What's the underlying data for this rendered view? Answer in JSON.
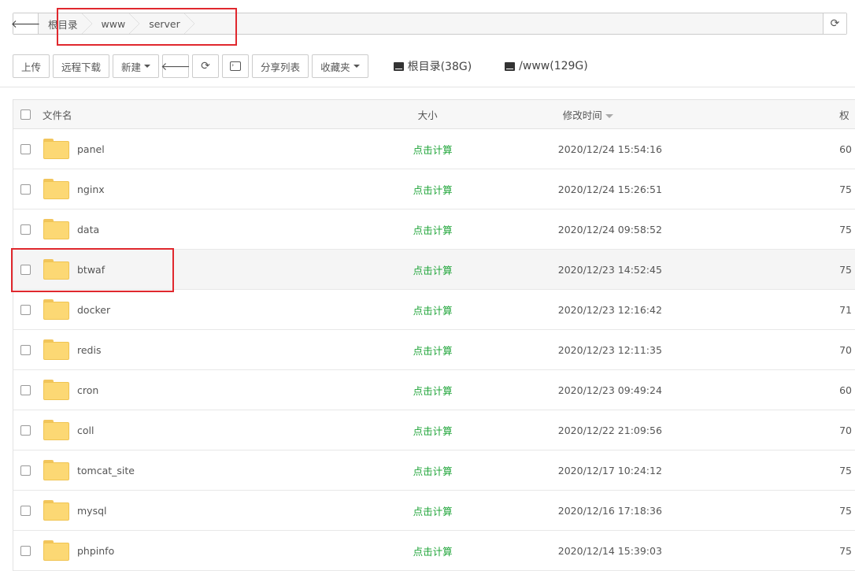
{
  "pathbar": {
    "back_icon": "arrow-left-icon",
    "crumbs": [
      "根目录",
      "www",
      "server"
    ],
    "refresh_icon": "refresh-icon"
  },
  "toolbar": {
    "upload": "上传",
    "remote_download": "远程下载",
    "new": "新建",
    "share_list": "分享列表",
    "favorites": "收藏夹",
    "disks": [
      {
        "label": "根目录(38G)",
        "icon": "hdd-icon"
      },
      {
        "label": "/www(129G)",
        "icon": "hdd-icon"
      }
    ]
  },
  "table": {
    "headers": {
      "name": "文件名",
      "size": "大小",
      "time": "修改时间",
      "perm": "权"
    },
    "rows": [
      {
        "name": "panel",
        "size": "点击计算",
        "time": "2020/12/24 15:54:16",
        "perm": "60"
      },
      {
        "name": "nginx",
        "size": "点击计算",
        "time": "2020/12/24 15:26:51",
        "perm": "75"
      },
      {
        "name": "data",
        "size": "点击计算",
        "time": "2020/12/24 09:58:52",
        "perm": "75"
      },
      {
        "name": "btwaf",
        "size": "点击计算",
        "time": "2020/12/23 14:52:45",
        "perm": "75"
      },
      {
        "name": "docker",
        "size": "点击计算",
        "time": "2020/12/23 12:16:42",
        "perm": "71"
      },
      {
        "name": "redis",
        "size": "点击计算",
        "time": "2020/12/23 12:11:35",
        "perm": "70"
      },
      {
        "name": "cron",
        "size": "点击计算",
        "time": "2020/12/23 09:49:24",
        "perm": "60"
      },
      {
        "name": "coll",
        "size": "点击计算",
        "time": "2020/12/22 21:09:56",
        "perm": "70"
      },
      {
        "name": "tomcat_site",
        "size": "点击计算",
        "time": "2020/12/17 10:24:12",
        "perm": "75"
      },
      {
        "name": "mysql",
        "size": "点击计算",
        "time": "2020/12/16 17:18:36",
        "perm": "75"
      },
      {
        "name": "phpinfo",
        "size": "点击计算",
        "time": "2020/12/14 15:39:03",
        "perm": "75"
      }
    ]
  },
  "colors": {
    "accent_green": "#20a53a",
    "annotation_red": "#e0282e",
    "folder": "#fcd874"
  }
}
